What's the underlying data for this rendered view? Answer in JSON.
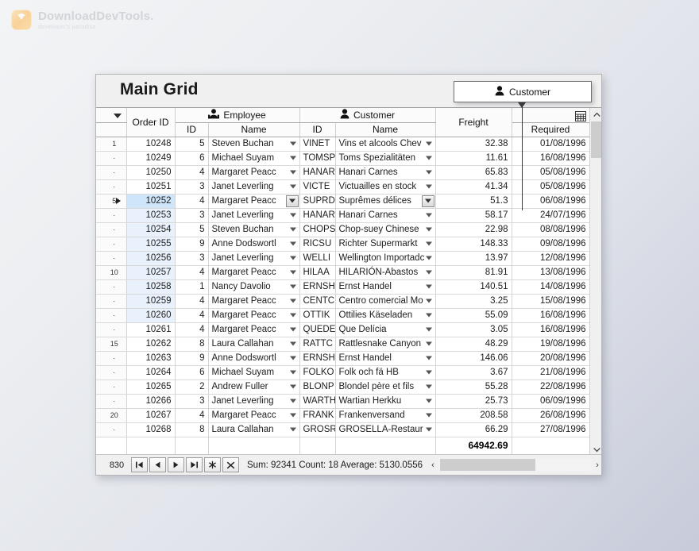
{
  "branding": {
    "logo_icon": "download-arrow-icon",
    "name": "DownloadDevTools.",
    "tagline": "developer's paradise"
  },
  "window": {
    "title": "Main Grid"
  },
  "drag_ghost": {
    "icon": "person-icon",
    "label": "Customer"
  },
  "grid": {
    "config_icon": "grid-settings-icon",
    "corner_filter_icon": "filter-triangle-icon",
    "group_headers": [
      {
        "label": "Order ID",
        "icon": null
      },
      {
        "label": "Employee",
        "icon": "people-icon"
      },
      {
        "label": "Customer",
        "icon": "person-icon"
      },
      {
        "label": "Freight",
        "icon": null
      },
      {
        "label": "Required",
        "icon": null
      }
    ],
    "sub_headers": {
      "employee_id": "ID",
      "employee_name": "Name",
      "customer_id": "ID",
      "customer_name": "Name"
    },
    "rows": [
      {
        "idx": "1",
        "order_id": "10248",
        "emp_id": "5",
        "emp_name": "Steven Buchan",
        "cust_id": "VINET",
        "cust_name": "Vins et alcools Chev",
        "freight": "32.38",
        "required": "01/08/1996",
        "current": false,
        "selected": false
      },
      {
        "idx": "·",
        "order_id": "10249",
        "emp_id": "6",
        "emp_name": "Michael Suyam",
        "cust_id": "TOMSP",
        "cust_name": "Toms Spezialitäten",
        "freight": "11.61",
        "required": "16/08/1996",
        "current": false,
        "selected": false
      },
      {
        "idx": "·",
        "order_id": "10250",
        "emp_id": "4",
        "emp_name": "Margaret Peacc",
        "cust_id": "HANAR",
        "cust_name": "Hanari Carnes",
        "freight": "65.83",
        "required": "05/08/1996",
        "current": false,
        "selected": false
      },
      {
        "idx": "·",
        "order_id": "10251",
        "emp_id": "3",
        "emp_name": "Janet Leverling",
        "cust_id": "VICTE",
        "cust_name": "Victuailles en stock",
        "freight": "41.34",
        "required": "05/08/1996",
        "current": false,
        "selected": false
      },
      {
        "idx": "5",
        "order_id": "10252",
        "emp_id": "4",
        "emp_name": "Margaret Peacc",
        "cust_id": "SUPRD",
        "cust_name": "Suprêmes délices",
        "freight": "51.3",
        "required": "06/08/1996",
        "current": true,
        "selected": true
      },
      {
        "idx": "·",
        "order_id": "10253",
        "emp_id": "3",
        "emp_name": "Janet Leverling",
        "cust_id": "HANAR",
        "cust_name": "Hanari Carnes",
        "freight": "58.17",
        "required": "24/07/1996",
        "current": false,
        "selected": true
      },
      {
        "idx": "·",
        "order_id": "10254",
        "emp_id": "5",
        "emp_name": "Steven Buchan",
        "cust_id": "CHOPS",
        "cust_name": "Chop-suey Chinese",
        "freight": "22.98",
        "required": "08/08/1996",
        "current": false,
        "selected": true
      },
      {
        "idx": "·",
        "order_id": "10255",
        "emp_id": "9",
        "emp_name": "Anne Dodswortl",
        "cust_id": "RICSU",
        "cust_name": "Richter Supermarkt",
        "freight": "148.33",
        "required": "09/08/1996",
        "current": false,
        "selected": true
      },
      {
        "idx": "·",
        "order_id": "10256",
        "emp_id": "3",
        "emp_name": "Janet Leverling",
        "cust_id": "WELLI",
        "cust_name": "Wellington Importadc",
        "freight": "13.97",
        "required": "12/08/1996",
        "current": false,
        "selected": true
      },
      {
        "idx": "10",
        "order_id": "10257",
        "emp_id": "4",
        "emp_name": "Margaret Peacc",
        "cust_id": "HILAA",
        "cust_name": "HILARIÓN-Abastos",
        "freight": "81.91",
        "required": "13/08/1996",
        "current": false,
        "selected": true
      },
      {
        "idx": "·",
        "order_id": "10258",
        "emp_id": "1",
        "emp_name": "Nancy Davolio",
        "cust_id": "ERNSH",
        "cust_name": "Ernst Handel",
        "freight": "140.51",
        "required": "14/08/1996",
        "current": false,
        "selected": true
      },
      {
        "idx": "·",
        "order_id": "10259",
        "emp_id": "4",
        "emp_name": "Margaret Peacc",
        "cust_id": "CENTC",
        "cust_name": "Centro comercial Mo",
        "freight": "3.25",
        "required": "15/08/1996",
        "current": false,
        "selected": true
      },
      {
        "idx": "·",
        "order_id": "10260",
        "emp_id": "4",
        "emp_name": "Margaret Peacc",
        "cust_id": "OTTIK",
        "cust_name": "Ottilies Käseladen",
        "freight": "55.09",
        "required": "16/08/1996",
        "current": false,
        "selected": true
      },
      {
        "idx": "·",
        "order_id": "10261",
        "emp_id": "4",
        "emp_name": "Margaret Peacc",
        "cust_id": "QUEDE",
        "cust_name": "Que Delícia",
        "freight": "3.05",
        "required": "16/08/1996",
        "current": false,
        "selected": false
      },
      {
        "idx": "15",
        "order_id": "10262",
        "emp_id": "8",
        "emp_name": "Laura Callahan",
        "cust_id": "RATTC",
        "cust_name": "Rattlesnake Canyon",
        "freight": "48.29",
        "required": "19/08/1996",
        "current": false,
        "selected": false
      },
      {
        "idx": "·",
        "order_id": "10263",
        "emp_id": "9",
        "emp_name": "Anne Dodswortl",
        "cust_id": "ERNSH",
        "cust_name": "Ernst Handel",
        "freight": "146.06",
        "required": "20/08/1996",
        "current": false,
        "selected": false
      },
      {
        "idx": "·",
        "order_id": "10264",
        "emp_id": "6",
        "emp_name": "Michael Suyam",
        "cust_id": "FOLKO",
        "cust_name": "Folk och fä HB",
        "freight": "3.67",
        "required": "21/08/1996",
        "current": false,
        "selected": false
      },
      {
        "idx": "·",
        "order_id": "10265",
        "emp_id": "2",
        "emp_name": "Andrew Fuller",
        "cust_id": "BLONP",
        "cust_name": "Blondel père et fils",
        "freight": "55.28",
        "required": "22/08/1996",
        "current": false,
        "selected": false
      },
      {
        "idx": "·",
        "order_id": "10266",
        "emp_id": "3",
        "emp_name": "Janet Leverling",
        "cust_id": "WARTH",
        "cust_name": "Wartian Herkku",
        "freight": "25.73",
        "required": "06/09/1996",
        "current": false,
        "selected": false
      },
      {
        "idx": "20",
        "order_id": "10267",
        "emp_id": "4",
        "emp_name": "Margaret Peacc",
        "cust_id": "FRANK",
        "cust_name": "Frankenversand",
        "freight": "208.58",
        "required": "26/08/1996",
        "current": false,
        "selected": false
      },
      {
        "idx": "·",
        "order_id": "10268",
        "emp_id": "8",
        "emp_name": "Laura Callahan",
        "cust_id": "GROSR",
        "cust_name": "GROSELLA-Restaur",
        "freight": "66.29",
        "required": "27/08/1996",
        "current": false,
        "selected": false
      }
    ],
    "footer": {
      "freight_total": "64942.69"
    }
  },
  "statusbar": {
    "record_count": "830",
    "nav_buttons": [
      {
        "name": "first-record-button",
        "glyph": "|◀"
      },
      {
        "name": "previous-record-button",
        "glyph": "◀"
      },
      {
        "name": "next-record-button",
        "glyph": "▶"
      },
      {
        "name": "last-record-button",
        "glyph": "▶|"
      },
      {
        "name": "new-record-button",
        "glyph": "✱"
      },
      {
        "name": "delete-record-button",
        "glyph": "✕"
      }
    ],
    "summary": "Sum: 92341  Count: 18  Average: 5130.0556",
    "hscroll_left_glyph": "‹",
    "hscroll_right_glyph": "›"
  },
  "colors": {
    "selection": "#cfe5fa",
    "selection_range": "#e9f2fc",
    "accent_logo": "#ffb74d"
  }
}
